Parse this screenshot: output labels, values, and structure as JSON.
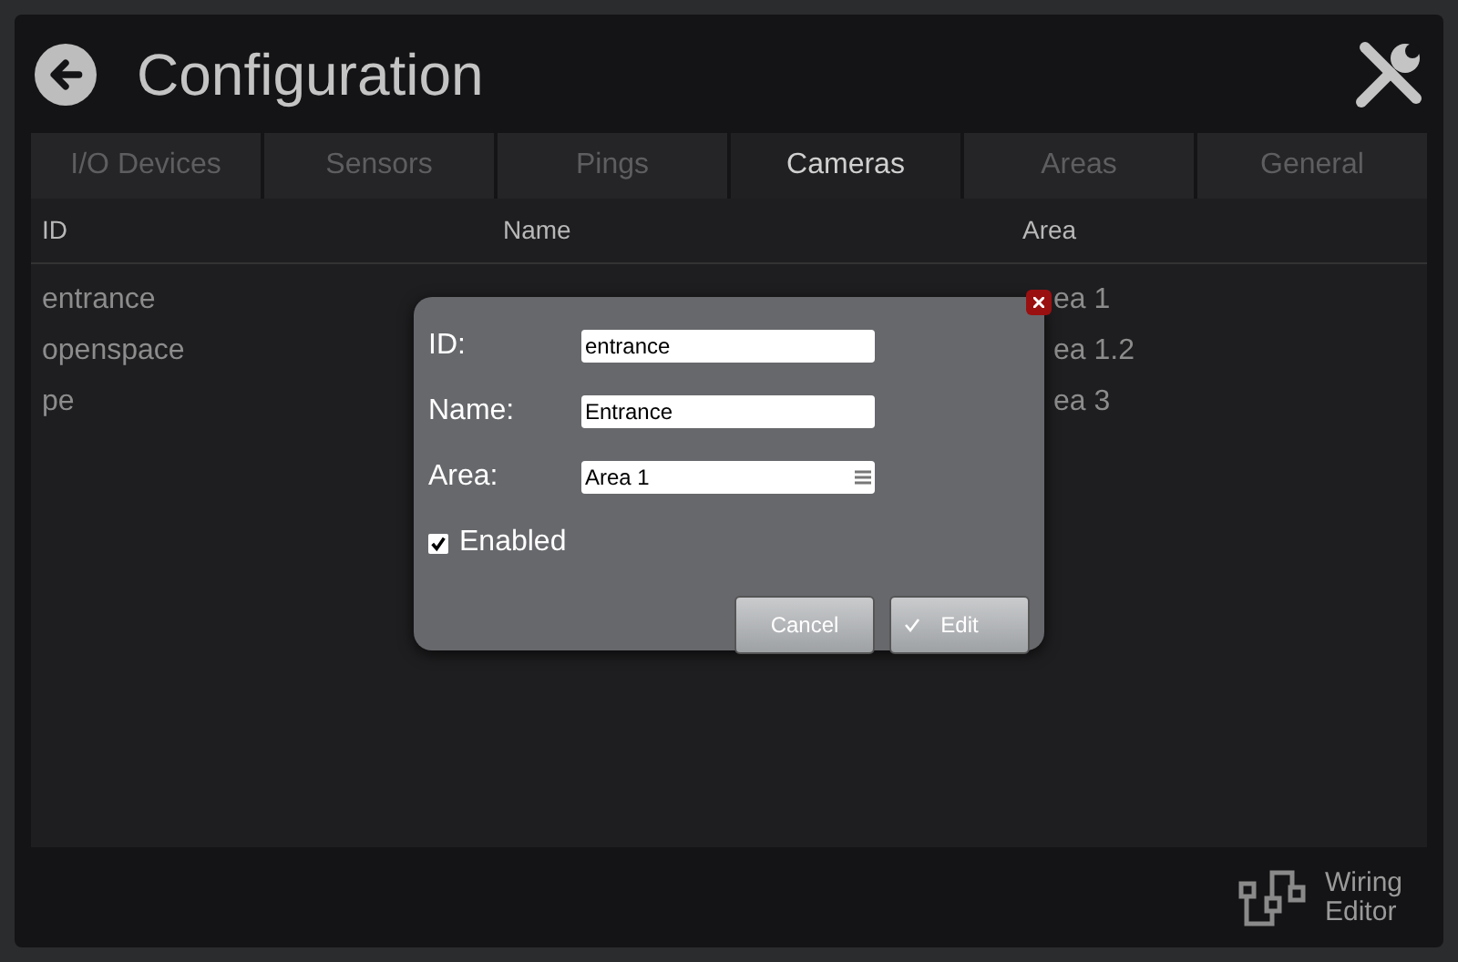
{
  "header": {
    "title": "Configuration"
  },
  "tabs": [
    {
      "label": "I/O Devices",
      "selected": false
    },
    {
      "label": "Sensors",
      "selected": false
    },
    {
      "label": "Pings",
      "selected": false
    },
    {
      "label": "Cameras",
      "selected": true
    },
    {
      "label": "Areas",
      "selected": false
    },
    {
      "label": "General",
      "selected": false
    }
  ],
  "table": {
    "columns": [
      "ID",
      "Name",
      "Area"
    ],
    "rows": [
      {
        "id": "entrance",
        "area": "ea 1"
      },
      {
        "id": "openspace",
        "area": "ea 1.2"
      },
      {
        "id": "pe",
        "area": "ea 3"
      }
    ]
  },
  "dialog": {
    "fields": [
      {
        "label": "ID:",
        "kind": "text",
        "value": "entrance"
      },
      {
        "label": "Name:",
        "kind": "text",
        "value": "Entrance"
      },
      {
        "label": "Area:",
        "kind": "select",
        "value": "Area 1"
      }
    ],
    "enabled": {
      "label": "Enabled",
      "checked": true
    },
    "buttons": [
      {
        "label": "Cancel",
        "kind": "plain"
      },
      {
        "label": "Edit",
        "kind": "confirm"
      }
    ]
  },
  "footer": {
    "wiring_editor": "Wiring Editor"
  }
}
